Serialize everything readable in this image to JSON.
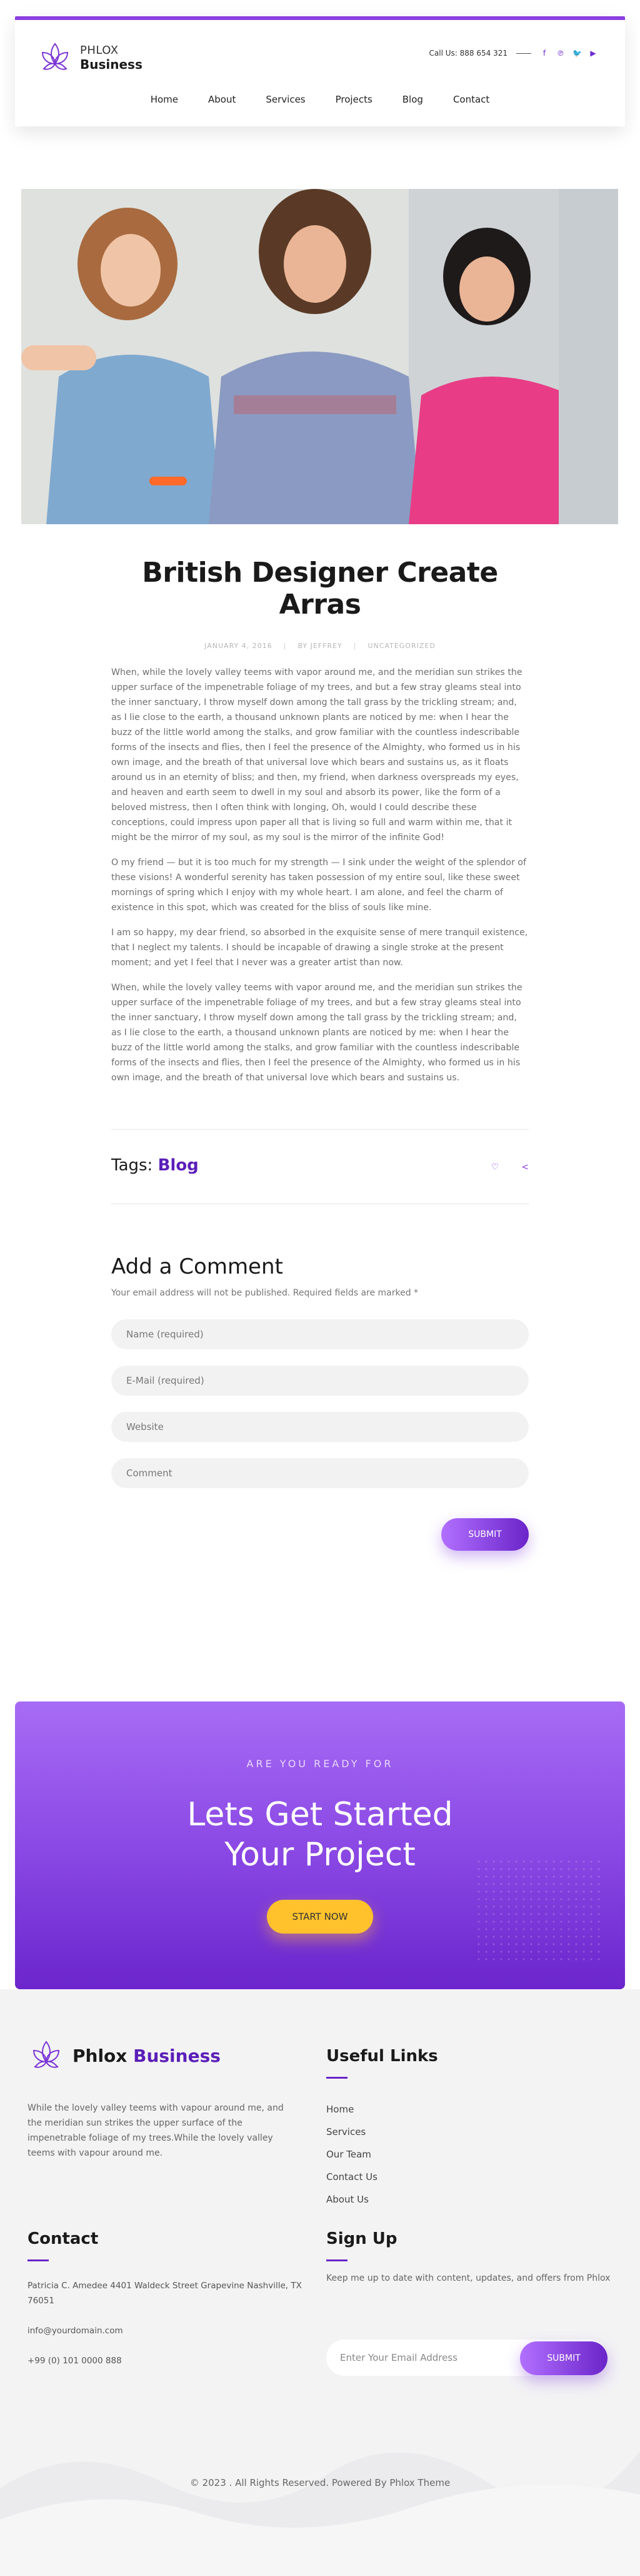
{
  "brand": {
    "line1": "PHLOX",
    "line2": "Business",
    "accent": "#8b3fe0",
    "dark_accent": "#5b1fb8"
  },
  "header": {
    "phone": "Call Us: 888 654 321",
    "social": [
      {
        "icon": "facebook-icon",
        "glyph": "f"
      },
      {
        "icon": "pinterest-icon",
        "glyph": "℗"
      },
      {
        "icon": "twitter-icon",
        "glyph": "🐦"
      },
      {
        "icon": "youtube-icon",
        "glyph": "▶"
      }
    ],
    "nav": [
      "Home",
      "About",
      "Services",
      "Projects",
      "Blog",
      "Contact"
    ]
  },
  "post": {
    "title": "British Designer Create Arras",
    "date": "JANUARY 4, 2016",
    "author": "BY JEFFREY",
    "category": "UNCATEGORIZED",
    "paragraphs": [
      "When, while the lovely valley teems with vapor around me, and the meridian sun strikes the upper surface of the impenetrable foliage of my trees, and but a few stray gleams steal into the inner sanctuary, I throw myself down among the tall grass by the trickling stream; and, as I lie close to the earth, a thousand unknown plants are noticed by me: when I hear the buzz of the little world among the stalks, and grow familiar with the countless indescribable forms of the insects and flies, then I feel the presence of the Almighty, who formed us in his own image, and the breath of that universal love which bears and sustains us, as it floats around us in an eternity of bliss; and then, my friend, when darkness overspreads my eyes, and heaven and earth seem to dwell in my soul and absorb its power, like the form of a beloved mistress, then I often think with longing, Oh, would I could describe these conceptions, could impress upon paper all that is living so full and warm within me, that it might be the mirror of my soul, as my soul is the mirror of the infinite God!",
      "O my friend — but it is too much for my strength — I sink under the weight of the splendor of these visions! A wonderful serenity has taken possession of my entire soul, like these sweet mornings of spring which I enjoy with my whole heart. I am alone, and feel the charm of existence in this spot, which was created for the bliss of souls like mine.",
      "I am so happy, my dear friend, so absorbed in the exquisite sense of mere tranquil existence, that I neglect my talents. I should be incapable of drawing a single stroke at the present moment; and yet I feel that I never was a greater artist than now.",
      "When, while the lovely valley teems with vapor around me, and the meridian sun strikes the upper surface of the impenetrable foliage of my trees, and but a few stray gleams steal into the inner sanctuary, I throw myself down among the tall grass by the trickling stream; and, as I lie close to the earth, a thousand unknown plants are noticed by me: when I hear the buzz of the little world among the stalks, and grow familiar with the countless indescribable forms of the insects and flies, then I feel the presence of the Almighty, who formed us in his own image, and the breath of that universal love which bears and sustains us."
    ],
    "tags_label": "Tags:",
    "tag": "Blog"
  },
  "comment_form": {
    "heading": "Add a Comment",
    "note": "Your email address will not be published. Required fields are marked *",
    "name_placeholder": "Name (required)",
    "email_placeholder": "E-Mail (required)",
    "website_placeholder": "Website",
    "comment_placeholder": "Comment",
    "submit": "SUBMIT"
  },
  "cta": {
    "kicker": "ARE YOU READY FOR",
    "title_line1": "Lets Get Started",
    "title_line2": "Your Project",
    "button": "START NOW",
    "button_color": "#ffc22d"
  },
  "footer": {
    "logo_a": "Phlox",
    "logo_b": "Business",
    "about": "While the lovely valley teems with vapour around me, and the meridian sun strikes the upper surface of the impenetrable foliage of my trees.While the lovely valley teems with vapour around me.",
    "links_heading": "Useful Links",
    "links": [
      "Home",
      "Services",
      "Our Team",
      "Contact Us",
      "About Us"
    ],
    "contact_heading": "Contact",
    "address": "Patricia C. Amedee 4401 Waldeck Street Grapevine Nashville, TX 76051",
    "email": "info@yourdomain.com",
    "phone": "+99 (0) 101 0000 888",
    "signup_heading": "Sign Up",
    "signup_text": "Keep me up to date with content, updates, and offers from Phlox",
    "email_placeholder": "Enter Your Email Address",
    "signup_button": "SUBMIT",
    "copyright": "© 2023 . All Rights Reserved. Powered By Phlox Theme"
  }
}
